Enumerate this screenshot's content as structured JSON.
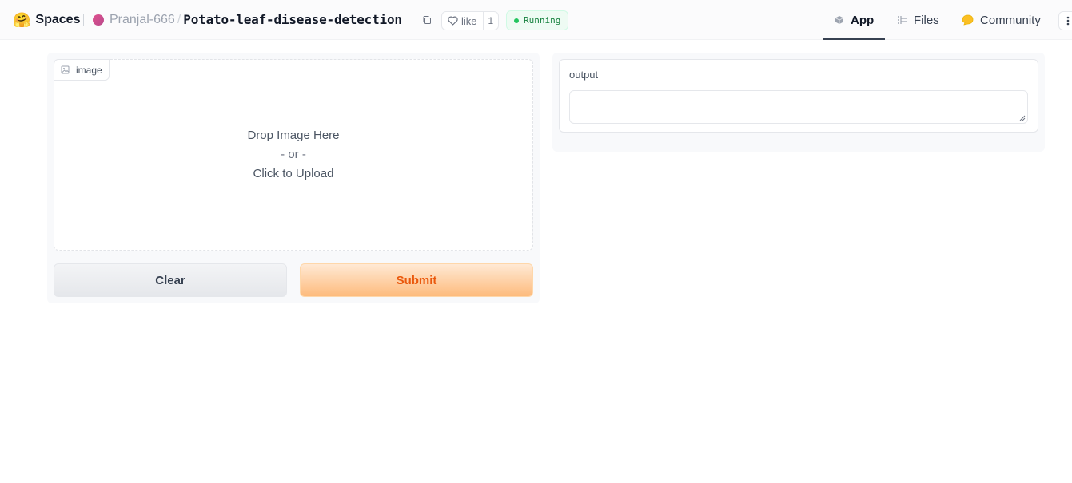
{
  "header": {
    "brand_emoji": "🤗",
    "brand_label": "Spaces",
    "owner": "Pranjal-666",
    "separator": "/",
    "repo": "Potato-leaf-disease-detection",
    "like_label": "like",
    "like_count": "1",
    "status": "Running",
    "status_color": "#22c55e"
  },
  "nav": {
    "app": "App",
    "files": "Files",
    "community": "Community"
  },
  "input": {
    "image_label": "image",
    "drop_line1": "Drop Image Here",
    "drop_line2": "- or -",
    "drop_line3": "Click to Upload"
  },
  "buttons": {
    "clear": "Clear",
    "submit": "Submit",
    "submit_color": "#ea580c"
  },
  "output": {
    "label": "output",
    "value": ""
  }
}
